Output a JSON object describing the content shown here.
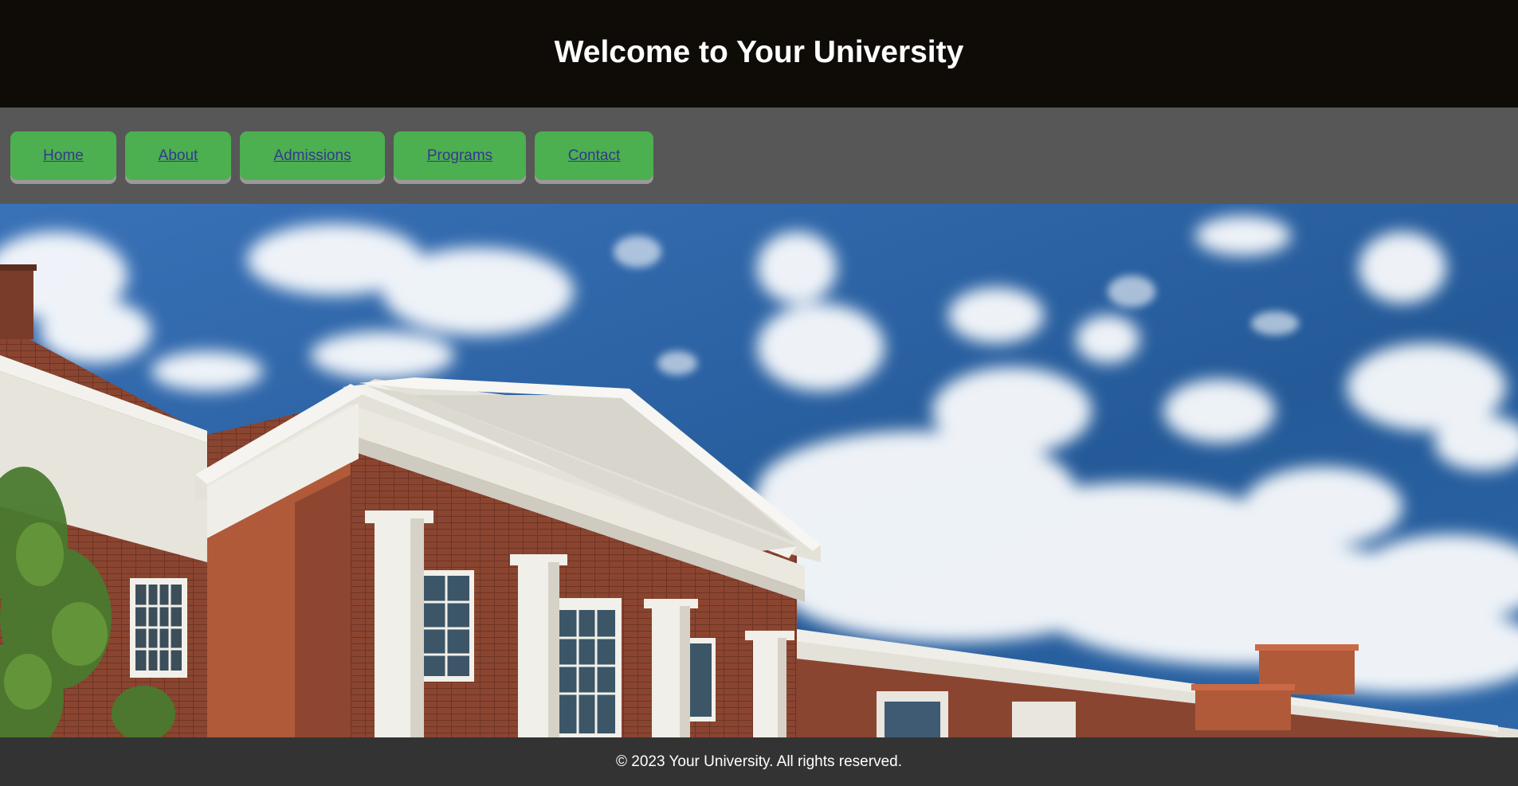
{
  "header": {
    "title": "Welcome to Your University"
  },
  "nav": {
    "items": [
      {
        "label": "Home"
      },
      {
        "label": "About"
      },
      {
        "label": "Admissions"
      },
      {
        "label": "Programs"
      },
      {
        "label": "Contact"
      }
    ]
  },
  "hero": {
    "image_description": "university-building-photo"
  },
  "footer": {
    "text": "© 2023 Your University. All rights reserved."
  },
  "colors": {
    "header_bg": "#0f0c08",
    "nav_bg": "#575757",
    "nav_button": "#4caf50",
    "nav_link": "#343a8c",
    "footer_bg": "#333333"
  }
}
